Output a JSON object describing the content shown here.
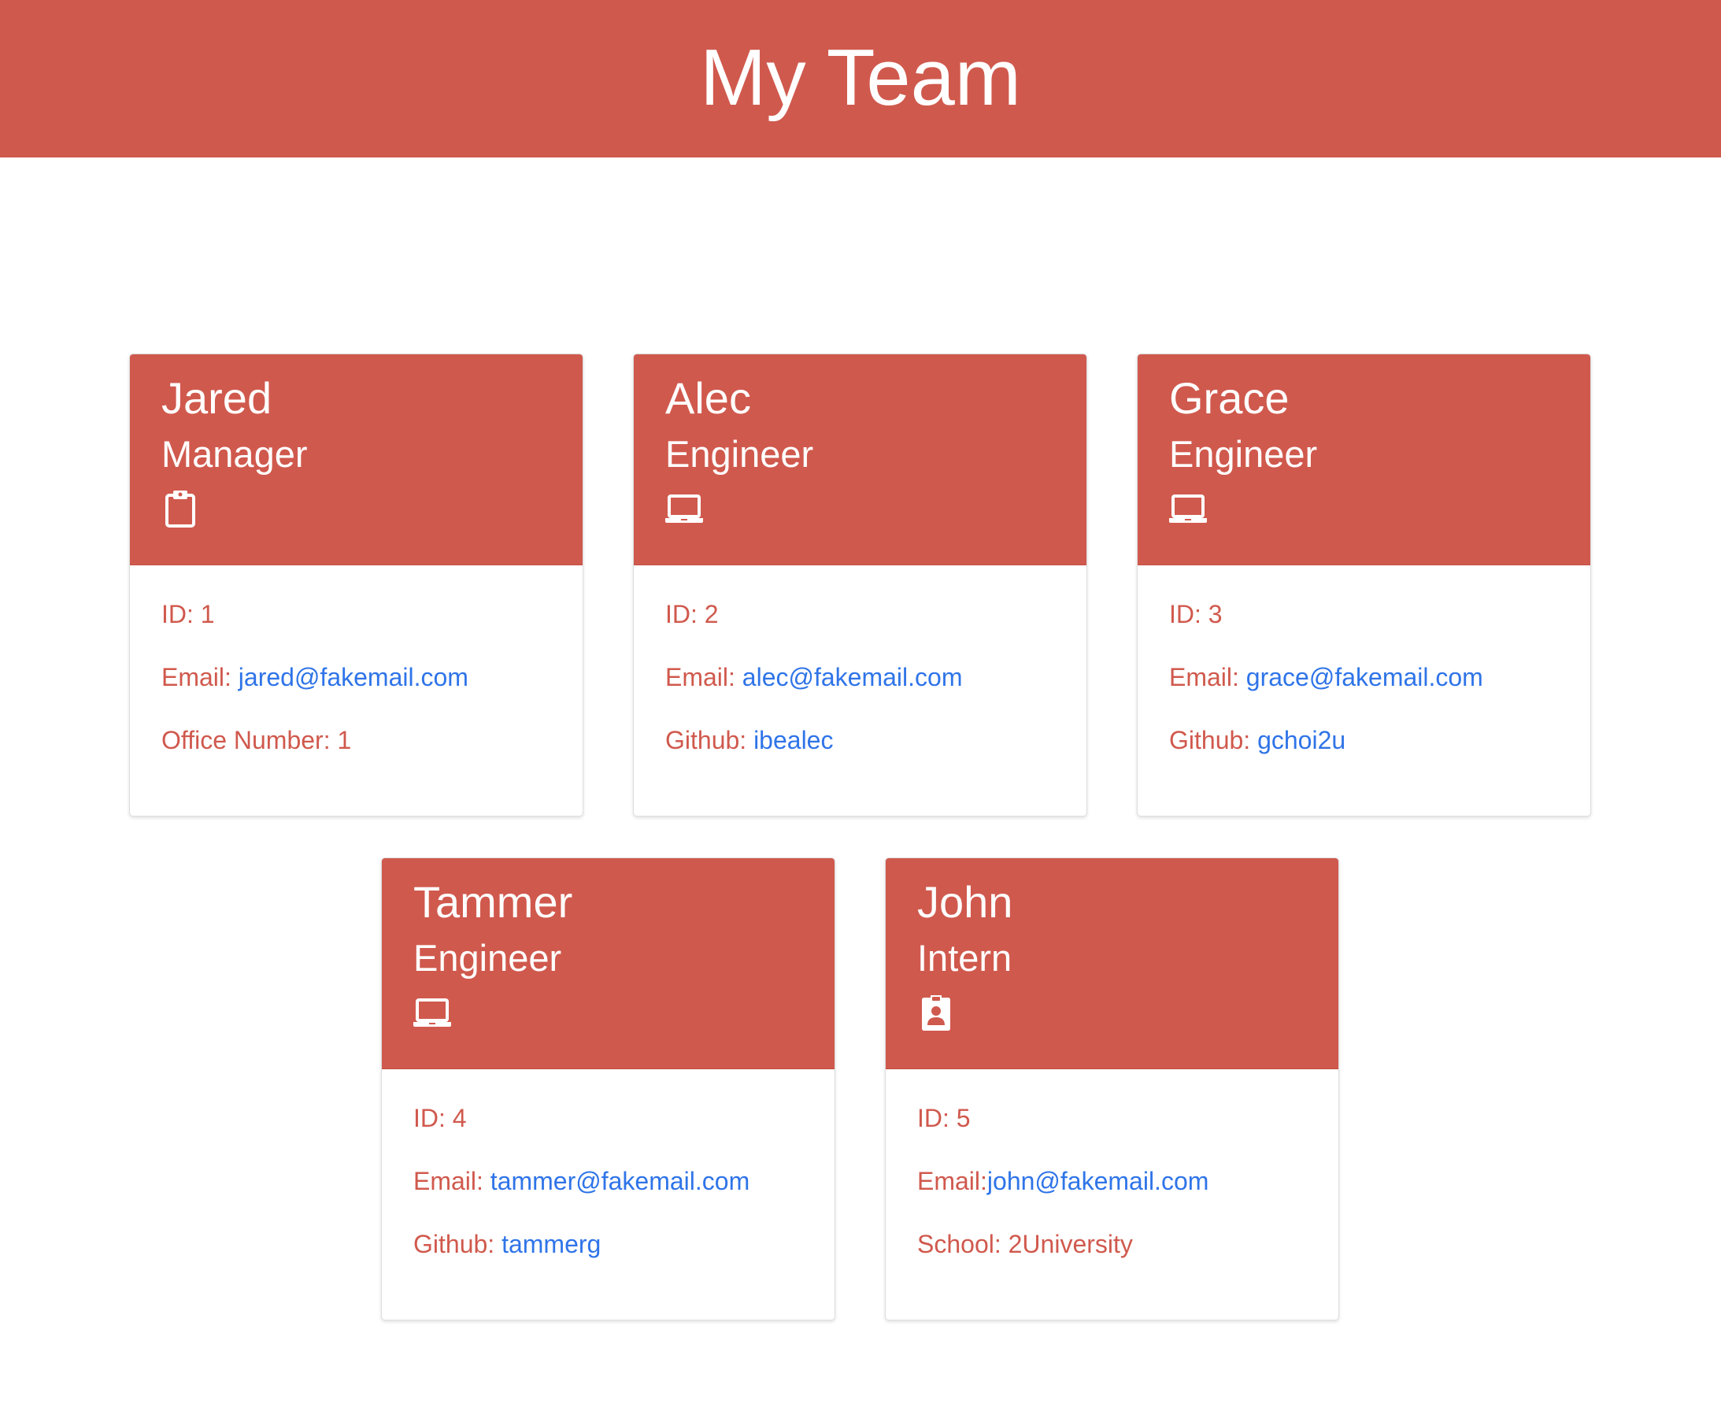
{
  "header": {
    "title": "My Team"
  },
  "colors": {
    "accent": "#d0594d",
    "link": "#2f74e8"
  },
  "cards": [
    {
      "name": "Jared",
      "role": "Manager",
      "icon": "clipboard-icon",
      "id_label": "ID:",
      "id": "1",
      "email_label": "Email:",
      "email": "jared@fakemail.com",
      "extra_label": "Office Number:",
      "extra": "1"
    },
    {
      "name": "Alec",
      "role": "Engineer",
      "icon": "laptop-icon",
      "id_label": "ID:",
      "id": "2",
      "email_label": "Email:",
      "email": "alec@fakemail.com",
      "extra_label": "Github:",
      "extra": "ibealec"
    },
    {
      "name": "Grace",
      "role": "Engineer",
      "icon": "laptop-icon",
      "id_label": "ID:",
      "id": "3",
      "email_label": "Email:",
      "email": "grace@fakemail.com",
      "extra_label": "Github:",
      "extra": "gchoi2u"
    },
    {
      "name": "Tammer",
      "role": "Engineer",
      "icon": "laptop-icon",
      "id_label": "ID:",
      "id": "4",
      "email_label": "Email:",
      "email": "tammer@fakemail.com",
      "extra_label": "Github:",
      "extra": "tammerg"
    },
    {
      "name": "John",
      "role": "Intern",
      "icon": "id-badge-icon",
      "id_label": "ID:",
      "id": "5",
      "email_label": "Email:",
      "email": "john@fakemail.com",
      "extra_label": "School:",
      "extra": "2University"
    }
  ]
}
